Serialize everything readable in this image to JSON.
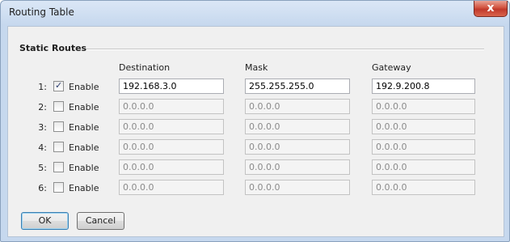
{
  "window": {
    "title": "Routing Table",
    "close_glyph": "x"
  },
  "group": {
    "label": "Static Routes"
  },
  "columns": {
    "destination": "Destination",
    "mask": "Mask",
    "gateway": "Gateway"
  },
  "routes": [
    {
      "num": "1:",
      "enabled": true,
      "enable_label": "Enable",
      "destination": "192.168.3.0",
      "mask": "255.255.255.0",
      "gateway": "192.9.200.8"
    },
    {
      "num": "2:",
      "enabled": false,
      "enable_label": "Enable",
      "destination": "0.0.0.0",
      "mask": "0.0.0.0",
      "gateway": "0.0.0.0"
    },
    {
      "num": "3:",
      "enabled": false,
      "enable_label": "Enable",
      "destination": "0.0.0.0",
      "mask": "0.0.0.0",
      "gateway": "0.0.0.0"
    },
    {
      "num": "4:",
      "enabled": false,
      "enable_label": "Enable",
      "destination": "0.0.0.0",
      "mask": "0.0.0.0",
      "gateway": "0.0.0.0"
    },
    {
      "num": "5:",
      "enabled": false,
      "enable_label": "Enable",
      "destination": "0.0.0.0",
      "mask": "0.0.0.0",
      "gateway": "0.0.0.0"
    },
    {
      "num": "6:",
      "enabled": false,
      "enable_label": "Enable",
      "destination": "0.0.0.0",
      "mask": "0.0.0.0",
      "gateway": "0.0.0.0"
    }
  ],
  "buttons": {
    "ok": "OK",
    "cancel": "Cancel"
  }
}
